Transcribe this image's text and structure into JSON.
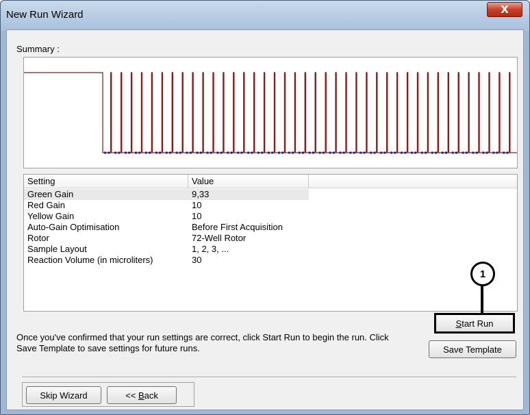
{
  "window": {
    "title": "New Run Wizard",
    "close_glyph": "X"
  },
  "summary": {
    "label": "Summary :"
  },
  "table": {
    "columns": [
      "Setting",
      "Value",
      ""
    ],
    "rows": [
      {
        "setting": "Green Gain",
        "value": "9,33"
      },
      {
        "setting": "Red Gain",
        "value": "10"
      },
      {
        "setting": "Yellow Gain",
        "value": "10"
      },
      {
        "setting": "Auto-Gain Optimisation",
        "value": "Before First Acquisition"
      },
      {
        "setting": "Rotor",
        "value": "72-Well Rotor"
      },
      {
        "setting": "Sample Layout",
        "value": "1, 2, 3, ..."
      },
      {
        "setting": "Reaction Volume (in microliters)",
        "value": "30"
      }
    ]
  },
  "callout": {
    "number": "1"
  },
  "buttons": {
    "start_run": {
      "mnemonic": "S",
      "rest": "tart Run"
    },
    "save_template": "Save Template",
    "skip_wizard": "Skip Wizard",
    "back": {
      "prefix": "<< ",
      "mnemonic": "B",
      "rest": "ack"
    }
  },
  "info_text": "Once you've confirmed that your run settings are correct, click Start Run to begin the run. Click Save Template to save settings for future runs.",
  "chart_data": {
    "type": "line",
    "title": "",
    "description_visible": "temperature profile step graph",
    "hold_level": "high",
    "cycle_count": 40,
    "colors": {
      "line": "#8b1a1a",
      "acquisition_marker": "#1a1a8b"
    }
  }
}
